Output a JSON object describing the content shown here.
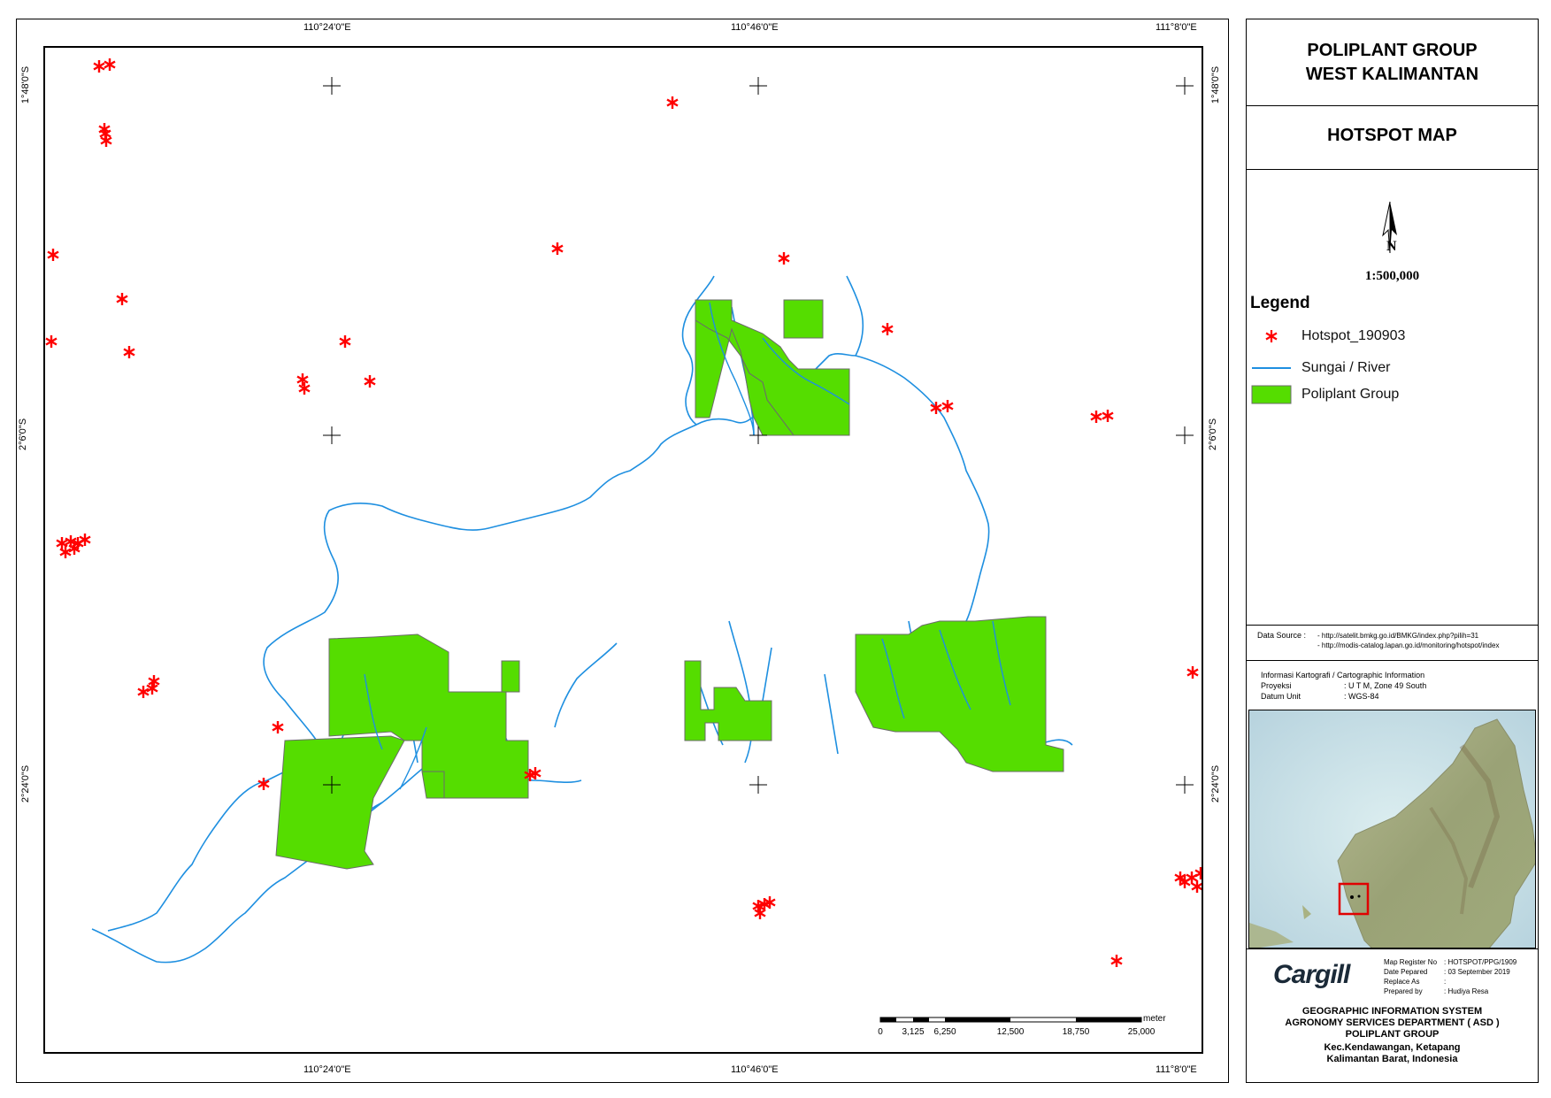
{
  "coords": {
    "top": [
      "110°24'0\"E",
      "110°46'0\"E",
      "111°8'0\"E"
    ],
    "bottom": [
      "110°24'0\"E",
      "110°46'0\"E",
      "111°8'0\"E"
    ],
    "left": [
      "1°48'0\"S",
      "2°6'0\"S",
      "2°24'0\"S"
    ],
    "right": [
      "1°48'0\"S",
      "2°6'0\"S",
      "2°24'0\"S"
    ]
  },
  "title": {
    "line1": "POLIPLANT GROUP",
    "line2": "WEST KALIMANTAN",
    "map_title": "HOTSPOT MAP",
    "north_label": "N",
    "scale": "1:500,000"
  },
  "legend": {
    "heading": "Legend",
    "items": [
      {
        "label": "Hotspot_190903",
        "symbol": "asterisk",
        "color": "#ff0000"
      },
      {
        "label": "Sungai / River",
        "symbol": "line",
        "color": "#1e8fe0"
      },
      {
        "label": "Poliplant Group",
        "symbol": "fill",
        "color": "#55dd00"
      }
    ]
  },
  "data_source": {
    "label": "Data Source :",
    "urls": [
      "- http://satelit.bmkg.go.id/BMKG/index.php?pilih=31",
      "- http://modis-catalog.lapan.go.id/monitoring/hotspot/index"
    ]
  },
  "cartographic": {
    "heading": "Informasi Kartografi / Cartographic Information",
    "rows": [
      {
        "key": "Proyeksi",
        "value": ": U T M, Zone 49 South"
      },
      {
        "key": "Datum Unit",
        "value": ": WGS-84"
      }
    ]
  },
  "scalebar": {
    "unit": "meter",
    "ticks": [
      "0",
      "3,125",
      "6,250",
      "12,500",
      "18,750",
      "25,000"
    ]
  },
  "register": {
    "logo": "Cargill",
    "rows": [
      {
        "key": "Map Register No",
        "value": ": HOTSPOT/PPG/1909"
      },
      {
        "key": "Date Pepared",
        "value": ": 03 September 2019"
      },
      {
        "key": "Replace As",
        "value": ":"
      },
      {
        "key": "Prepared by",
        "value": ": Hudiya Resa"
      }
    ]
  },
  "footer": {
    "lines": [
      "GEOGRAPHIC INFORMATION SYSTEM",
      "AGRONOMY SERVICES DEPARTMENT ( ASD )",
      "POLIPLANT GROUP",
      "Kec.Kendawangan, Ketapang",
      "Kalimantan Barat, Indonesia"
    ]
  },
  "colors": {
    "hotspot": "#ff0000",
    "river": "#1e8fe0",
    "concession": "#55dd00",
    "concession_border": "#6b6b6b"
  },
  "hotspot_count": 48
}
